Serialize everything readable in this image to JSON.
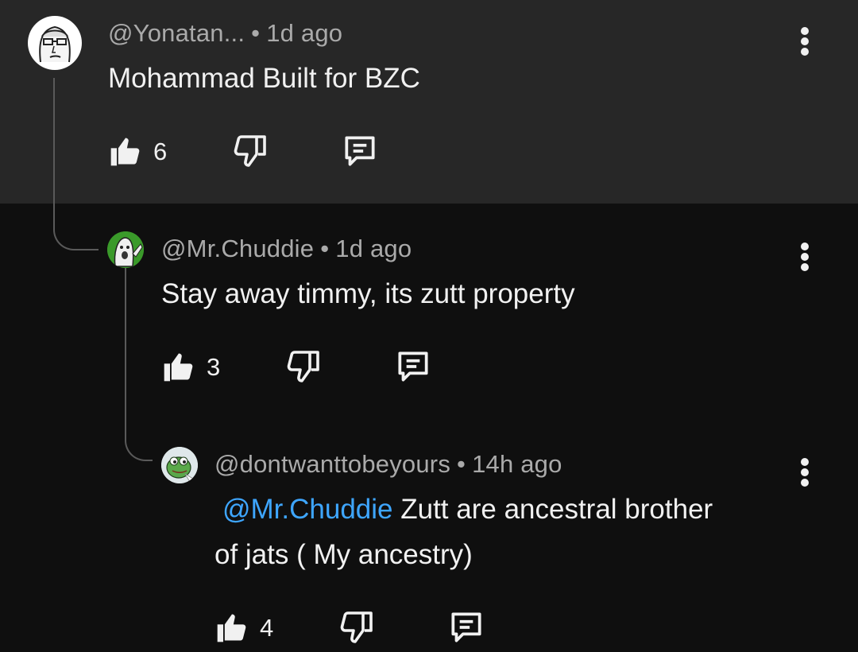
{
  "comments": [
    {
      "author": "@Yonatan...",
      "time": "1d ago",
      "body": "Mohammad Built for BZC",
      "likes": "6"
    },
    {
      "author": "@Mr.Chuddie",
      "time": "1d ago",
      "body": "Stay away timmy, its zutt property",
      "likes": "3"
    },
    {
      "author": "@dontwanttobeyours",
      "time": "14h ago",
      "mention": "@Mr.Chuddie",
      "body_line1": " Zutt are ancestral brother",
      "body_line2": "of jats ( My ancestry)",
      "likes": "4"
    }
  ],
  "separator": "•",
  "colors": {
    "highlight_bg": "#272727",
    "page_bg": "#0f0f0f",
    "mention": "#3ea6ff",
    "meta_text": "#aaaaaa"
  },
  "icons": [
    "avatar",
    "thumbs-up-icon",
    "thumbs-down-icon",
    "reply-icon",
    "more-vert-icon"
  ]
}
